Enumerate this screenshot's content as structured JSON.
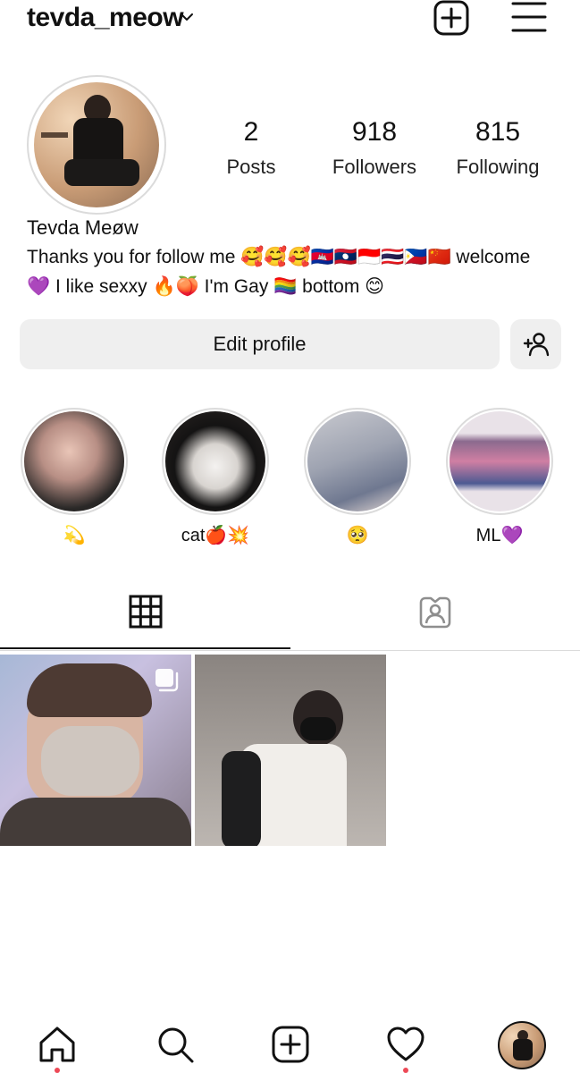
{
  "header": {
    "username": "tevda_meow",
    "icons": [
      "chevron-down-icon",
      "new-post-icon",
      "menu-icon"
    ]
  },
  "profile": {
    "stats": [
      {
        "value": "2",
        "label": "Posts"
      },
      {
        "value": "918",
        "label": "Followers"
      },
      {
        "value": "815",
        "label": "Following"
      }
    ],
    "display_name": "Tevda Meøw",
    "bio_line1": "Thanks you for follow me 🥰🥰🥰🇰🇭🇱🇦🇮🇩🇹🇭🇵🇭🇨🇳 welcome",
    "bio_line2": "💜 I like sexxy 🔥🍑 I'm Gay 🏳️‍🌈 bottom 😊"
  },
  "actions": {
    "edit_profile_label": "Edit profile"
  },
  "highlights": [
    {
      "label": "💫"
    },
    {
      "label": "cat🍎💥"
    },
    {
      "label": "🥺"
    },
    {
      "label": "ML💜"
    }
  ],
  "tabs": [
    "grid-icon",
    "tagged-icon"
  ],
  "posts": [
    {
      "multiple": true
    },
    {
      "multiple": false
    }
  ],
  "bottom_nav": [
    "home-icon",
    "search-icon",
    "create-icon",
    "activity-icon",
    "profile-avatar"
  ],
  "colors": {
    "notification_dot": "#ed4956",
    "button_bg": "#efefef",
    "ring": "#dbdbdb"
  }
}
